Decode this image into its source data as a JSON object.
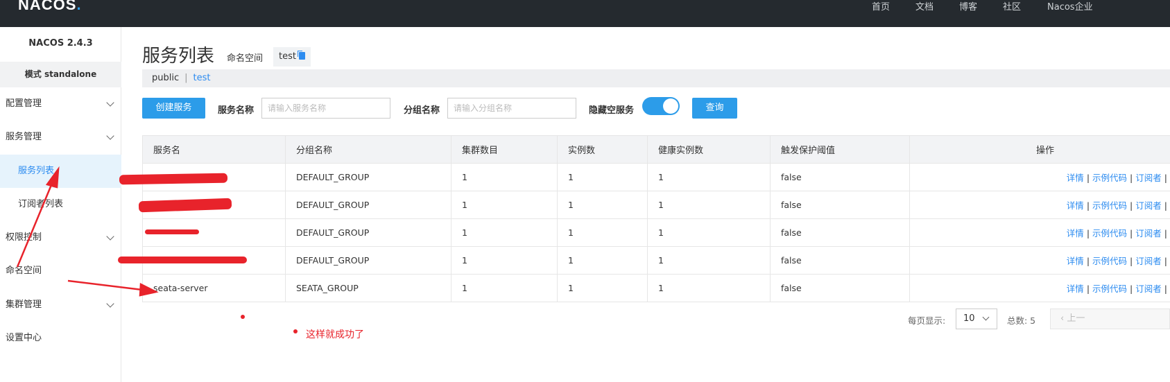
{
  "header": {
    "logo_main": "NACOS",
    "logo_dot": ".",
    "nav": [
      "首页",
      "文档",
      "博客",
      "社区",
      "Nacos企业"
    ]
  },
  "sidebar": {
    "version": "NACOS 2.4.3",
    "mode": "模式 standalone",
    "items": [
      {
        "label": "配置管理"
      },
      {
        "label": "服务管理"
      },
      {
        "label": "服务列表"
      },
      {
        "label": "订阅者列表"
      },
      {
        "label": "权限控制"
      },
      {
        "label": "命名空间"
      },
      {
        "label": "集群管理"
      },
      {
        "label": "设置中心"
      }
    ]
  },
  "main": {
    "title": "服务列表",
    "namespace_label": "命名空间",
    "namespace_value": "test",
    "namespaces": {
      "public": "public",
      "separator": "|",
      "current": "test"
    },
    "create_button": "创建服务",
    "service_name_label": "服务名称",
    "service_name_placeholder": "请输入服务名称",
    "group_name_label": "分组名称",
    "group_name_placeholder": "请输入分组名称",
    "hide_empty_label": "隐藏空服务",
    "hide_empty_on": true,
    "query_button": "查询"
  },
  "table": {
    "headers": [
      "服务名",
      "分组名称",
      "集群数目",
      "实例数",
      "健康实例数",
      "触发保护阈值",
      "操作"
    ],
    "rows": [
      {
        "name": "",
        "group": "DEFAULT_GROUP",
        "clusters": "1",
        "instances": "1",
        "healthy": "1",
        "threshold": "false"
      },
      {
        "name": "",
        "group": "DEFAULT_GROUP",
        "clusters": "1",
        "instances": "1",
        "healthy": "1",
        "threshold": "false"
      },
      {
        "name": "",
        "group": "DEFAULT_GROUP",
        "clusters": "1",
        "instances": "1",
        "healthy": "1",
        "threshold": "false"
      },
      {
        "name": "",
        "group": "DEFAULT_GROUP",
        "clusters": "1",
        "instances": "1",
        "healthy": "1",
        "threshold": "false"
      },
      {
        "name": "seata-server",
        "group": "SEATA_GROUP",
        "clusters": "1",
        "instances": "1",
        "healthy": "1",
        "threshold": "false"
      }
    ],
    "actions": {
      "details": "详情",
      "sample_code": "示例代码",
      "subscribers": "订阅者",
      "sep": "|"
    }
  },
  "pagination": {
    "per_page_label": "每页显示:",
    "per_page_value": "10",
    "total_label": "总数: 5",
    "prev_label": "上一"
  },
  "annotation": {
    "text": "这样就成功了",
    "color": "#e8232b"
  },
  "colors": {
    "topbar": "#252a2f",
    "primary": "#2c9ce9",
    "link": "#2d8cf0",
    "active_bg": "#e6f3fc"
  }
}
